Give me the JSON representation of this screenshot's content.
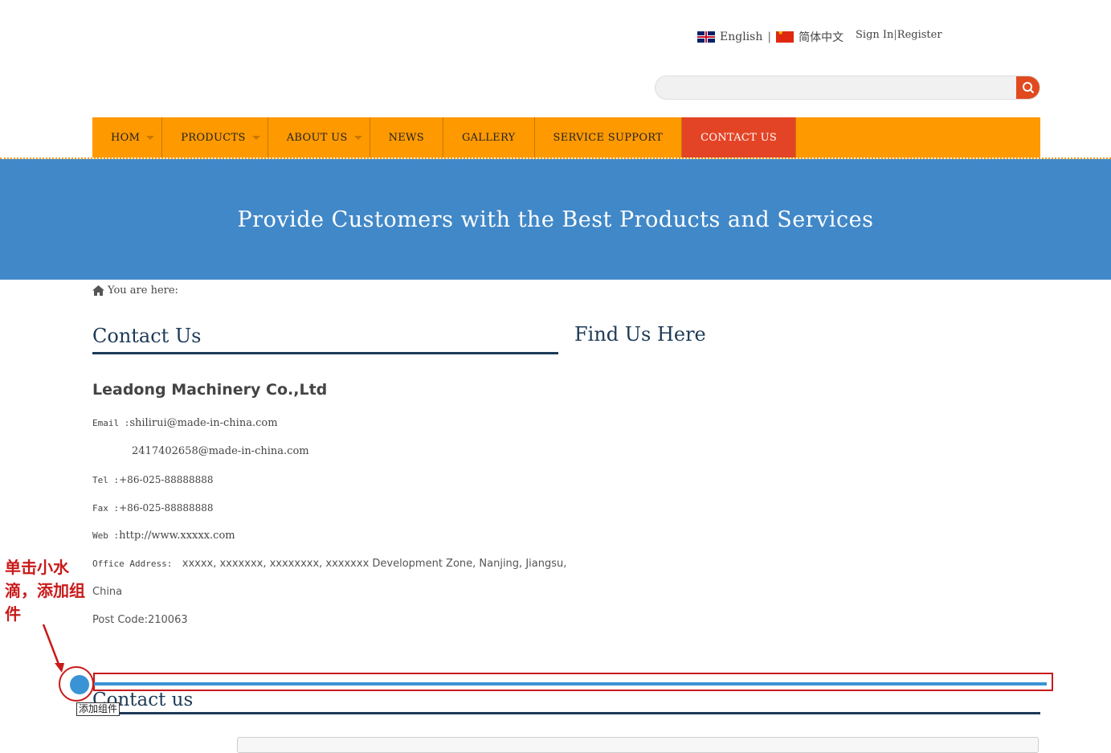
{
  "header": {
    "lang_english": "English",
    "lang_chinese": "简体中文",
    "sign_in": "Sign In",
    "register": "Register",
    "search_placeholder": ""
  },
  "nav": {
    "items": [
      {
        "label": "HOM"
      },
      {
        "label": "PRODUCTS"
      },
      {
        "label": "ABOUT US"
      },
      {
        "label": "NEWS"
      },
      {
        "label": "GALLERY"
      },
      {
        "label": "SERVICE SUPPORT"
      },
      {
        "label": "CONTACT US"
      }
    ]
  },
  "banner": {
    "text": "Provide Customers with the Best Products and Services"
  },
  "breadcrumb": {
    "label": "You are here:"
  },
  "contact": {
    "heading": "Contact Us",
    "company": "Leadong Machinery Co.,Ltd",
    "email_label": "Email :",
    "email1": "shilirui@made-in-china.com",
    "email2": "2417402658@made-in-china.com",
    "tel_label": "Tel :",
    "tel": "+86-025-88888888",
    "fax_label": "Fax :",
    "fax": "+86-025-88888888",
    "web_label": "Web :",
    "web": "http://www.xxxxx.com",
    "address_label": "Office Address:",
    "address_line1": "xxxxx, xxxxxxx, xxxxxxxx, xxxxxxx Development Zone, Nanjing, Jiangsu,",
    "address_line2": "China",
    "postcode": "Post Code:210063"
  },
  "find": {
    "heading": "Find Us Here"
  },
  "annotation": {
    "text": "单击小水滴，添加组件",
    "tooltip": "添加组件"
  },
  "section2": {
    "heading": "Contact us"
  },
  "colors": {
    "nav_bg": "#ff9900",
    "nav_active": "#e44426",
    "banner_bg": "#4188c8",
    "heading": "#1d3a57",
    "annotation": "#c91a1a"
  }
}
